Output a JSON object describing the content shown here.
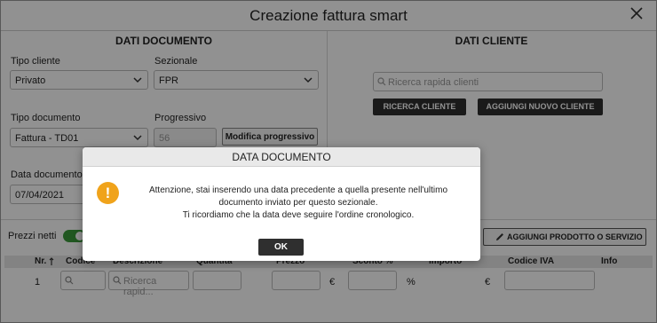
{
  "window": {
    "title": "Creazione fattura smart"
  },
  "documento": {
    "heading": "DATI DOCUMENTO",
    "tipo_cliente": {
      "label": "Tipo cliente",
      "value": "Privato"
    },
    "sezionale": {
      "label": "Sezionale",
      "value": "FPR"
    },
    "tipo_documento": {
      "label": "Tipo documento",
      "value": "Fattura - TD01"
    },
    "progressivo": {
      "label": "Progressivo",
      "value": "56",
      "button": "Modifica progressivo"
    },
    "data_documento": {
      "label": "Data documento",
      "value": "07/04/2021"
    }
  },
  "cliente": {
    "heading": "DATI CLIENTE",
    "search_placeholder": "Ricerca rapida clienti",
    "btn_ricerca": "RICERCA CLIENTE",
    "btn_nuovo": "AGGIUNGI NUOVO CLIENTE"
  },
  "prodotti": {
    "prezzi_netti_label": "Prezzi netti",
    "btn_add": "AGGIUNGI PRODOTTO O SERVIZIO",
    "columns": [
      "Nr.",
      "Codice",
      "Descrizione",
      "Quantità",
      "Prezzo",
      "Sconto %",
      "Importo",
      "Codice IVA",
      "Info"
    ],
    "row": {
      "nr": "1",
      "search_placeholder": "Ricerca rapid...",
      "currency": "€",
      "percent": "%",
      "currency2": "€"
    }
  },
  "modal": {
    "title": "DATA DOCUMENTO",
    "message_1": "Attenzione, stai inserendo una data precedente a quella presente nell'ultimo documento inviato per questo sezionale.",
    "message_2": "Ti ricordiamo che la data deve seguire l'ordine cronologico.",
    "ok_label": "OK"
  },
  "colors": {
    "accent_warning": "#f0a31b",
    "toggle_on": "#3a9a3a",
    "dark_button": "#2f2f2f"
  }
}
